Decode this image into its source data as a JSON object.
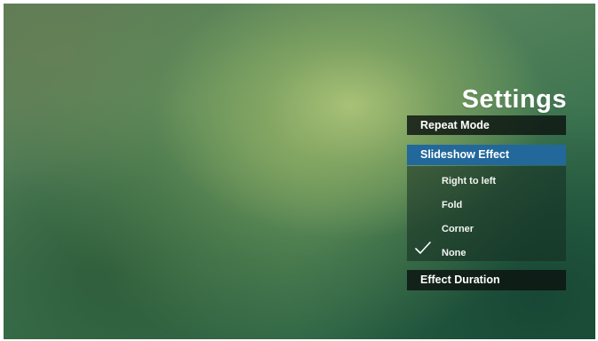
{
  "settings": {
    "title": "Settings",
    "menu": {
      "repeat_mode": "Repeat Mode",
      "slideshow_effect": "Slideshow Effect",
      "effect_duration": "Effect Duration"
    },
    "slideshow_options": [
      {
        "label": "Right to left",
        "selected": false
      },
      {
        "label": "Fold",
        "selected": false
      },
      {
        "label": "Corner",
        "selected": false
      },
      {
        "label": "None",
        "selected": true
      }
    ],
    "colors": {
      "highlight": "#23689b",
      "menu_background": "#0c1410",
      "text": "#ffffff"
    },
    "icons": {
      "selected_marker": "checkmark-icon"
    }
  }
}
